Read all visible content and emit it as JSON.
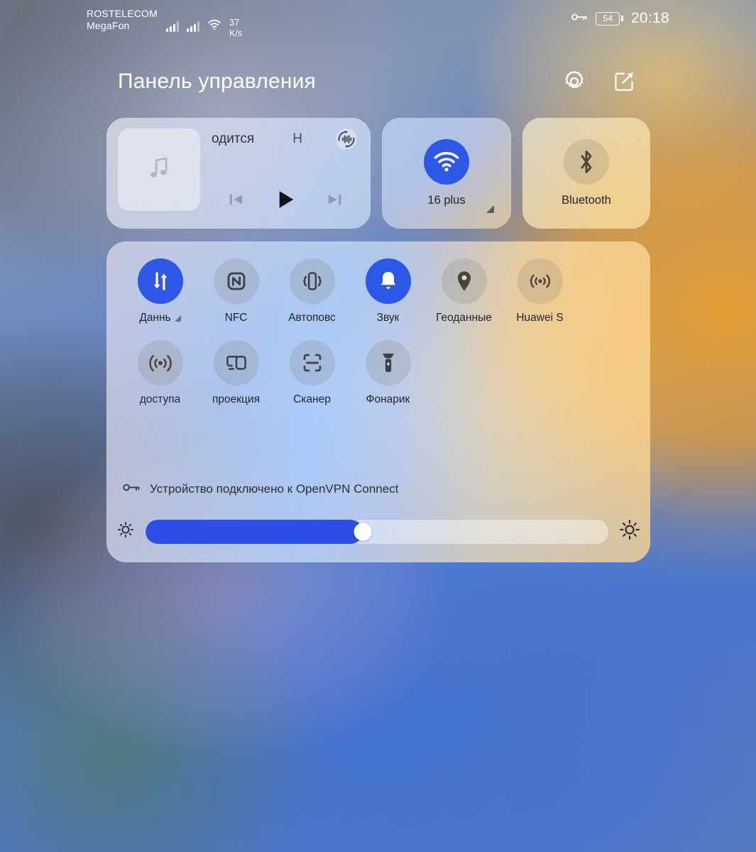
{
  "status_bar": {
    "carrier_primary": "ROSTELECOM",
    "carrier_secondary": "MegaFon",
    "network_speed_value": "37",
    "network_speed_unit": "K/s",
    "vpn_key_icon": "key-icon",
    "battery_percent": "54",
    "time": "20:18",
    "signal_icon_1": "signal-bars-icon",
    "signal_icon_2": "signal-bars-icon",
    "wifi_icon": "wifi-icon"
  },
  "header": {
    "title": "Панель управления",
    "settings_icon": "gear-icon",
    "edit_icon": "edit-square-icon"
  },
  "media": {
    "album_art_icon": "music-note-icon",
    "track_title": "одится",
    "track_title_secondary": "Н",
    "cast_icon": "audio-output-switch-icon",
    "previous_icon": "skip-previous-icon",
    "play_icon": "play-icon",
    "next_icon": "skip-next-icon"
  },
  "tiles": [
    {
      "name": "wifi",
      "label": "16 plus",
      "icon": "wifi-icon",
      "active": true,
      "expandable": true
    },
    {
      "name": "bluetooth",
      "label": "Bluetooth",
      "icon": "bluetooth-icon",
      "active": false,
      "expandable": false
    }
  ],
  "toggles": [
    {
      "name": "mobile-data",
      "label": "Даннь",
      "icon": "mobile-data-icon",
      "active": true,
      "expandable": true
    },
    {
      "name": "nfc",
      "label": "NFC",
      "icon": "nfc-icon",
      "active": false,
      "expandable": false
    },
    {
      "name": "auto-rotate",
      "label": "Автоповс",
      "icon": "auto-rotate-icon",
      "active": false,
      "expandable": false
    },
    {
      "name": "sound",
      "label": "Звук",
      "icon": "bell-icon",
      "active": true,
      "expandable": false
    },
    {
      "name": "location",
      "label": "Геоданные",
      "icon": "location-pin-icon",
      "active": false,
      "expandable": false
    },
    {
      "name": "huawei-share",
      "label": "Huawei S",
      "icon": "huawei-share-icon",
      "active": false,
      "expandable": false
    },
    {
      "name": "hotspot",
      "label": "доступа",
      "icon": "hotspot-icon",
      "active": false,
      "expandable": false
    },
    {
      "name": "projection",
      "label": "проекция",
      "icon": "projection-icon",
      "active": false,
      "expandable": false
    },
    {
      "name": "scanner",
      "label": "Сканер",
      "icon": "scanner-icon",
      "active": false,
      "expandable": false
    },
    {
      "name": "flashlight",
      "label": "Фонарик",
      "icon": "flashlight-icon",
      "active": false,
      "expandable": false
    }
  ],
  "vpn_notice": {
    "icon": "key-icon",
    "text": "Устройство подключено к OpenVPN Connect"
  },
  "brightness": {
    "low_icon": "brightness-low-icon",
    "high_icon": "brightness-high-icon",
    "value_percent": 47
  },
  "colors": {
    "accent_blue": "#2d57e6",
    "slider_blue": "#2d4fe8",
    "text_dark": "#23262c",
    "status_text": "#ffffff"
  }
}
